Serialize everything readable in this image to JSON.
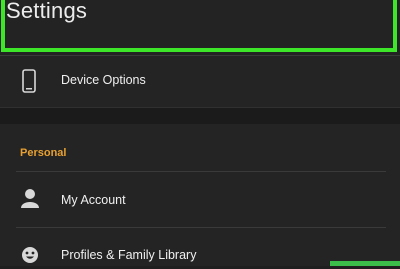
{
  "header": {
    "title": "Settings"
  },
  "device": {
    "label": "Device Options",
    "icon": "phone-icon"
  },
  "personal": {
    "section_label": "Personal",
    "items": [
      {
        "label": "My Account",
        "icon": "person-icon"
      },
      {
        "label": "Profiles & Family Library",
        "icon": "smiley-icon"
      }
    ]
  },
  "colors": {
    "accent": "#e8a032",
    "highlight": "#3ee62a"
  }
}
